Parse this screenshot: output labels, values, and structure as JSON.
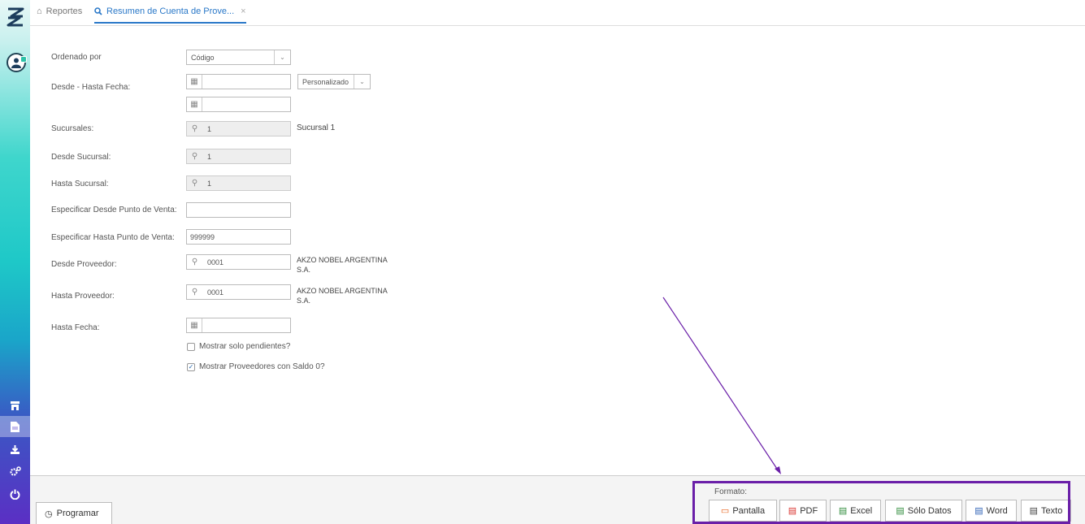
{
  "tabs": {
    "home_label": "Reportes",
    "active_label": "Resumen de Cuenta de Prove...",
    "close": "×"
  },
  "form": {
    "ordenado_label": "Ordenado por",
    "ordenado_value": "Código",
    "desde_hasta_label": "Desde - Hasta Fecha:",
    "periodo_value": "Personalizado",
    "sucursales_label": "Sucursales:",
    "sucursales_value": "1",
    "sucursales_name": "Sucursal 1",
    "desde_sucursal_label": "Desde Sucursal:",
    "desde_sucursal_value": "1",
    "hasta_sucursal_label": "Hasta Sucursal:",
    "hasta_sucursal_value": "1",
    "desde_pv_label": "Especificar Desde Punto de Venta:",
    "desde_pv_value": "",
    "hasta_pv_label": "Especificar Hasta Punto de Venta:",
    "hasta_pv_value": "999999",
    "desde_prov_label": "Desde Proveedor:",
    "desde_prov_value": "0001",
    "desde_prov_name_1": "AKZO NOBEL ARGENTINA",
    "desde_prov_name_2": "S.A.",
    "hasta_prov_label": "Hasta Proveedor:",
    "hasta_prov_value": "0001",
    "hasta_prov_name_1": "AKZO NOBEL ARGENTINA",
    "hasta_prov_name_2": "S.A.",
    "hasta_fecha_label": "Hasta Fecha:",
    "chk_pendientes_label": "Mostrar solo pendientes?",
    "chk_pendientes_checked": false,
    "chk_saldo0_label": "Mostrar Proveedores con Saldo 0?",
    "chk_saldo0_checked": true
  },
  "footer": {
    "programar_label": "Programar",
    "formato_label": "Formato:",
    "buttons": {
      "pantalla": "Pantalla",
      "pdf": "PDF",
      "excel": "Excel",
      "solo_datos": "Sólo Datos",
      "word": "Word",
      "texto": "Texto"
    }
  },
  "colors": {
    "accent": "#2a78c8",
    "highlight_box": "#6a1fa8",
    "pdf_icon": "#d9302c",
    "excel_icon": "#2e8b3a",
    "word_icon": "#2b5fb4",
    "pantalla_icon": "#e8611a"
  }
}
